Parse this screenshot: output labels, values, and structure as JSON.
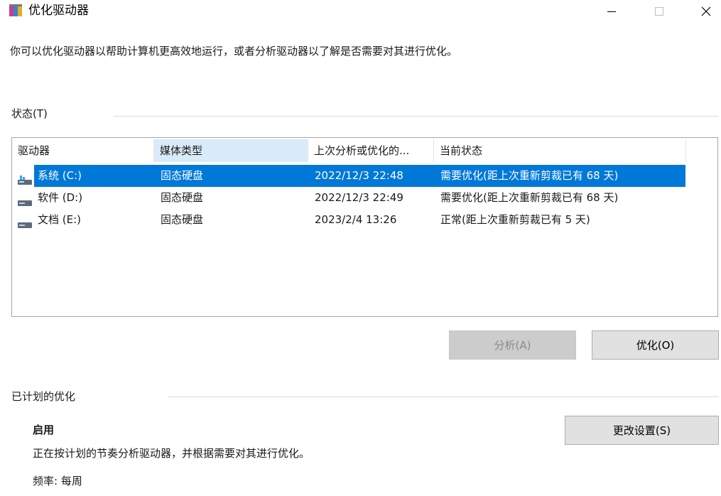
{
  "window": {
    "title": "优化驱动器",
    "minimize_glyph": "—",
    "close_glyph": "✕"
  },
  "intro_text": "你可以优化驱动器以帮助计算机更高效地运行，或者分析驱动器以了解是否需要对其进行优化。",
  "status_section": {
    "label": "状态(T)",
    "columns": [
      "驱动器",
      "媒体类型",
      "上次分析或优化的...",
      "当前状态"
    ],
    "sorted_column": "媒体类型",
    "drives": [
      {
        "name": "系统 (C:)",
        "media": "固态硬盘",
        "last_run": "2022/12/3 22:48",
        "status": "需要优化(距上次重新剪裁已有 68 天)",
        "selected": true,
        "icon": "system-drive-icon"
      },
      {
        "name": "软件 (D:)",
        "media": "固态硬盘",
        "last_run": "2022/12/3 22:49",
        "status": "需要优化(距上次重新剪裁已有 68 天)",
        "selected": false,
        "icon": "drive-icon"
      },
      {
        "name": "文档 (E:)",
        "media": "固态硬盘",
        "last_run": "2023/2/4 13:26",
        "status": "正常(距上次重新剪裁已有 5 天)",
        "selected": false,
        "icon": "drive-icon"
      }
    ]
  },
  "actions": {
    "analyze_label": "分析(A)",
    "optimize_label": "优化(O)"
  },
  "scheduled_section": {
    "label": "已计划的优化",
    "status": "启用",
    "description": "正在按计划的节奏分析驱动器，并根据需要对其进行优化。",
    "frequency": "频率: 每周",
    "change_settings_label": "更改设置(S)"
  },
  "colors": {
    "selection": "#0078d7",
    "sorted_header": "#d9ebf9",
    "button_face": "#e1e1e1"
  }
}
